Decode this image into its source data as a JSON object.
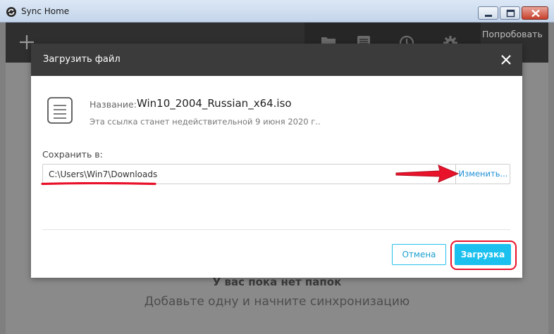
{
  "window": {
    "title": "Sync Home"
  },
  "header": {
    "try_label": "Попробовать"
  },
  "empty_state": {
    "title": "У вас пока нет папок",
    "subtitle": "Добавьте одну и начните синхронизацию"
  },
  "dialog": {
    "title": "Загрузить файл",
    "name_label": "Название:",
    "file_name": "Win10_2004_Russian_x64.iso",
    "expiry_note": "Эта ссылка станет недействительной 9 июня 2020 г..",
    "save_label": "Сохранить в:",
    "save_path": "C:\\Users\\Win7\\Downloads",
    "change_label": "Изменить...",
    "cancel_label": "Отмена",
    "upload_label": "Загрузка"
  },
  "colors": {
    "accent": "#1cc0ee",
    "annotation": "#e8132b",
    "header": "#2f2f2f",
    "dialog_header": "#3b3b3b"
  },
  "icons": [
    "sync-app-icon",
    "minimize-icon",
    "maximize-icon",
    "close-icon",
    "plus-icon",
    "folder-icon",
    "list-icon",
    "clock-icon",
    "gear-icon",
    "document-icon",
    "red-arrow-icon"
  ]
}
